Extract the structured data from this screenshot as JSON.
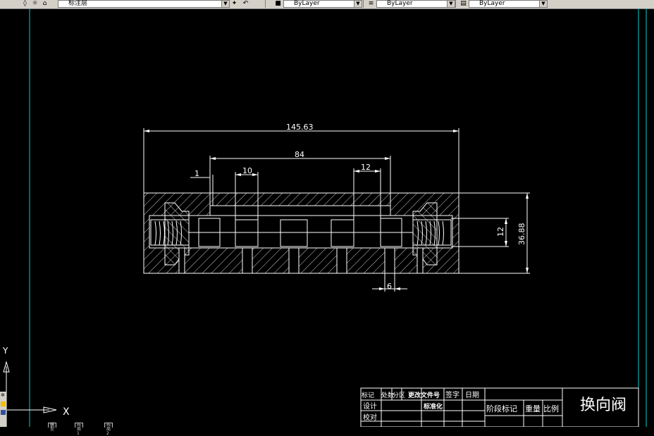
{
  "toolbar": {
    "layer_name": "标注层",
    "combo_color": "ByLayer",
    "combo_linetype": "ByLayer",
    "combo_lineweight": "ByLayer"
  },
  "drawing": {
    "dimensions": {
      "overall_length": "145.63",
      "inner_length": "84",
      "offset": "1",
      "land_width_left": "10",
      "land_width_right": "12",
      "vertical_small": "12",
      "overall_height": "36.88",
      "port_width": "6"
    }
  },
  "ucs": {
    "x_label": "X",
    "y_label": "Y"
  },
  "title_block": {
    "headers": [
      "标记",
      "处数",
      "分区",
      "更改文件号",
      "签字",
      "日期"
    ],
    "row_design": "设计",
    "row_standard": "标准化",
    "row_check": "校对",
    "stage_mark": "阶段标记",
    "weight": "重量",
    "scale": "比例",
    "drawing_name": "换向阀"
  },
  "layout_tabs": [
    "模型",
    "布局1",
    "布局2"
  ],
  "colors": {
    "background": "#000000",
    "drawing_lines": "#ffffff",
    "border_lines": "#00d0d0",
    "toolbar": "#d4d0c8"
  }
}
